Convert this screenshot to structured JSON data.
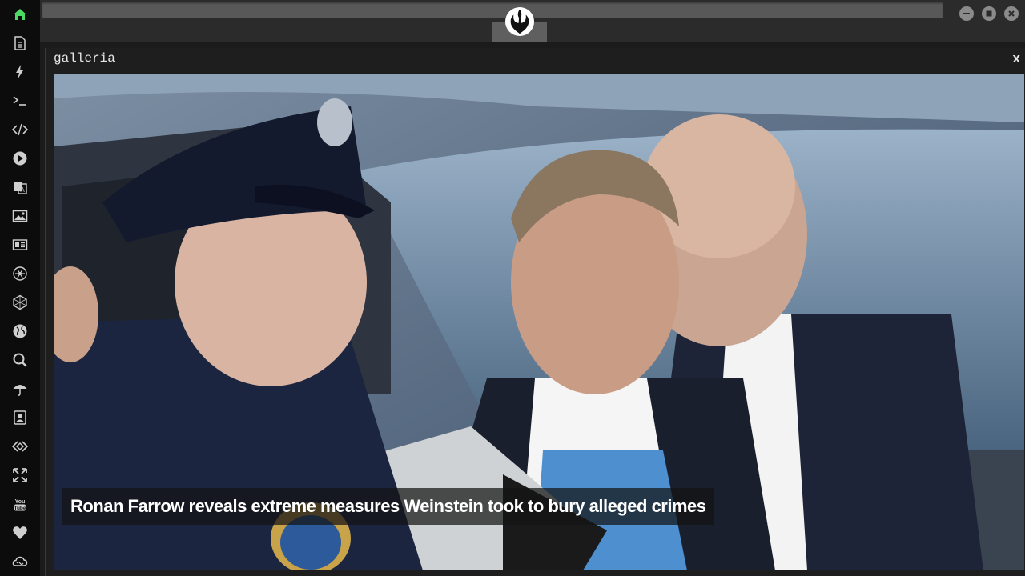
{
  "sidebar": {
    "items": [
      {
        "icon": "home-icon",
        "color": "#4cd964"
      },
      {
        "icon": "document-icon"
      },
      {
        "icon": "lightning-icon"
      },
      {
        "icon": "terminal-icon"
      },
      {
        "icon": "code-icon"
      },
      {
        "icon": "play-icon"
      },
      {
        "icon": "translate-icon"
      },
      {
        "icon": "image-icon"
      },
      {
        "icon": "news-icon"
      },
      {
        "icon": "atom-icon"
      },
      {
        "icon": "cube-icon"
      },
      {
        "icon": "globe-icon"
      },
      {
        "icon": "search-icon"
      },
      {
        "icon": "umbrella-icon"
      },
      {
        "icon": "contact-icon"
      },
      {
        "icon": "api-icon"
      },
      {
        "icon": "expand-icon"
      },
      {
        "icon": "youtube-icon"
      },
      {
        "icon": "heart-icon"
      },
      {
        "icon": "cloud-icon"
      }
    ]
  },
  "topbar": {
    "logo": "rebel-alliance-icon",
    "window_controls": [
      "minimize-icon",
      "maximize-icon",
      "close-icon"
    ]
  },
  "panel": {
    "title": "galleria",
    "close_label": "x",
    "caption": "Ronan Farrow reveals extreme measures Weinstein took to bury alleged crimes"
  },
  "colors": {
    "sidebar_bg": "#0c0c0c",
    "accent_green": "#4cd964",
    "icon_gray": "#cfcfcf"
  }
}
